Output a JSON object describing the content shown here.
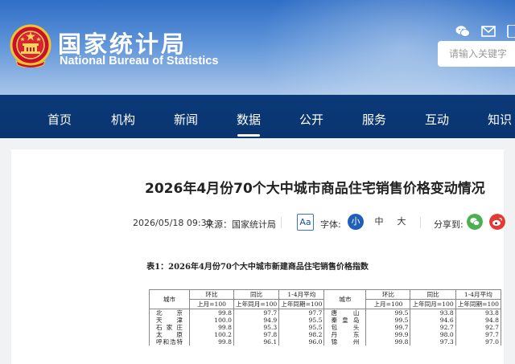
{
  "header": {
    "logo_cn": "国家统计局",
    "logo_en": "National Bureau of Statistics",
    "search_placeholder": "请输入关键字",
    "icons": [
      "wechat-icon",
      "email-icon",
      "mobile-icon"
    ]
  },
  "nav": {
    "items": [
      {
        "label": "首页"
      },
      {
        "label": "机构"
      },
      {
        "label": "新闻"
      },
      {
        "label": "数据",
        "active": true
      },
      {
        "label": "公开"
      },
      {
        "label": "服务"
      },
      {
        "label": "互动"
      },
      {
        "label": "知识"
      }
    ]
  },
  "article": {
    "title": "2026年4月份70个大中城市商品住宅销售价格变动情况",
    "datetime": "2026/05/18 09:30",
    "source": "来源：国家统计局",
    "font_label": "字体:",
    "font_toggle": "Aa",
    "sizes": [
      "小",
      "中",
      "大"
    ],
    "share_label": "分享到:",
    "share_icons": [
      "wechat-share-icon",
      "weibo-share-icon"
    ]
  },
  "table": {
    "caption": "表1：2026年4月份70个大中城市新建商品住宅销售价格指数",
    "city_header": "城市",
    "col_groups": [
      "环比",
      "同比",
      "1-4月平均"
    ],
    "col_bases": [
      "上月=100",
      "上年同月=100",
      "上年同期=100"
    ],
    "left_rows": [
      {
        "city": "北　京",
        "mom": "99.8",
        "yoy": "97.7",
        "avg": "97.7"
      },
      {
        "city": "天　津",
        "mom": "100.0",
        "yoy": "94.9",
        "avg": "95.5"
      },
      {
        "city": "石家庄",
        "mom": "99.8",
        "yoy": "95.3",
        "avg": "95.5"
      },
      {
        "city": "太　原",
        "mom": "100.2",
        "yoy": "97.8",
        "avg": "98.2"
      },
      {
        "city": "呼和浩特",
        "mom": "99.8",
        "yoy": "96.1",
        "avg": "96.0"
      }
    ],
    "right_rows": [
      {
        "city": "唐　山",
        "mom": "99.5",
        "yoy": "93.8",
        "avg": "93.8"
      },
      {
        "city": "秦皇岛",
        "mom": "99.5",
        "yoy": "94.6",
        "avg": "94.8"
      },
      {
        "city": "包　头",
        "mom": "99.7",
        "yoy": "92.7",
        "avg": "92.7"
      },
      {
        "city": "丹　东",
        "mom": "99.9",
        "yoy": "98.0",
        "avg": "97.7"
      },
      {
        "city": "锦　州",
        "mom": "99.8",
        "yoy": "97.3",
        "avg": "97.0"
      }
    ]
  }
}
